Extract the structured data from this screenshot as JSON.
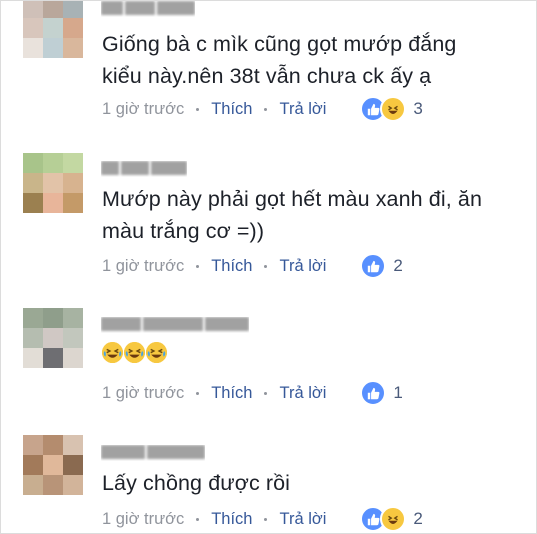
{
  "theme": {
    "link_color": "#365899",
    "muted_color": "#90949c",
    "text_color": "#1d2129",
    "like_color": "#5890ff",
    "haha_color": "#f7c840"
  },
  "comments": [
    {
      "text_lines": [
        "Giống bà c mìk cũng gọt mướp đắng",
        "kiểu này.nên 38t vẫn chưa ck ấy ạ"
      ],
      "time": "1 giờ trước",
      "like": "Thích",
      "reply": "Trả lời",
      "reactions": [
        "like-icon",
        "haha-icon"
      ],
      "count": "3"
    },
    {
      "text_lines": [
        "Mướp này phải gọt hết màu xanh đi, ăn",
        "màu trắng cơ =))"
      ],
      "time": "1 giờ trước",
      "like": "Thích",
      "reply": "Trả lời",
      "reactions": [
        "like-icon"
      ],
      "count": "2"
    },
    {
      "text_lines": [],
      "emojis": [
        "laughing-tears-emoji",
        "laughing-tears-emoji",
        "laughing-tears-emoji"
      ],
      "time": "1 giờ trước",
      "like": "Thích",
      "reply": "Trả lời",
      "reactions": [
        "like-icon"
      ],
      "count": "1"
    },
    {
      "text_lines": [
        "Lấy chồng được rồi"
      ],
      "time": "1 giờ trước",
      "like": "Thích",
      "reply": "Trả lời",
      "reactions": [
        "like-icon",
        "haha-icon"
      ],
      "count": "2"
    }
  ]
}
